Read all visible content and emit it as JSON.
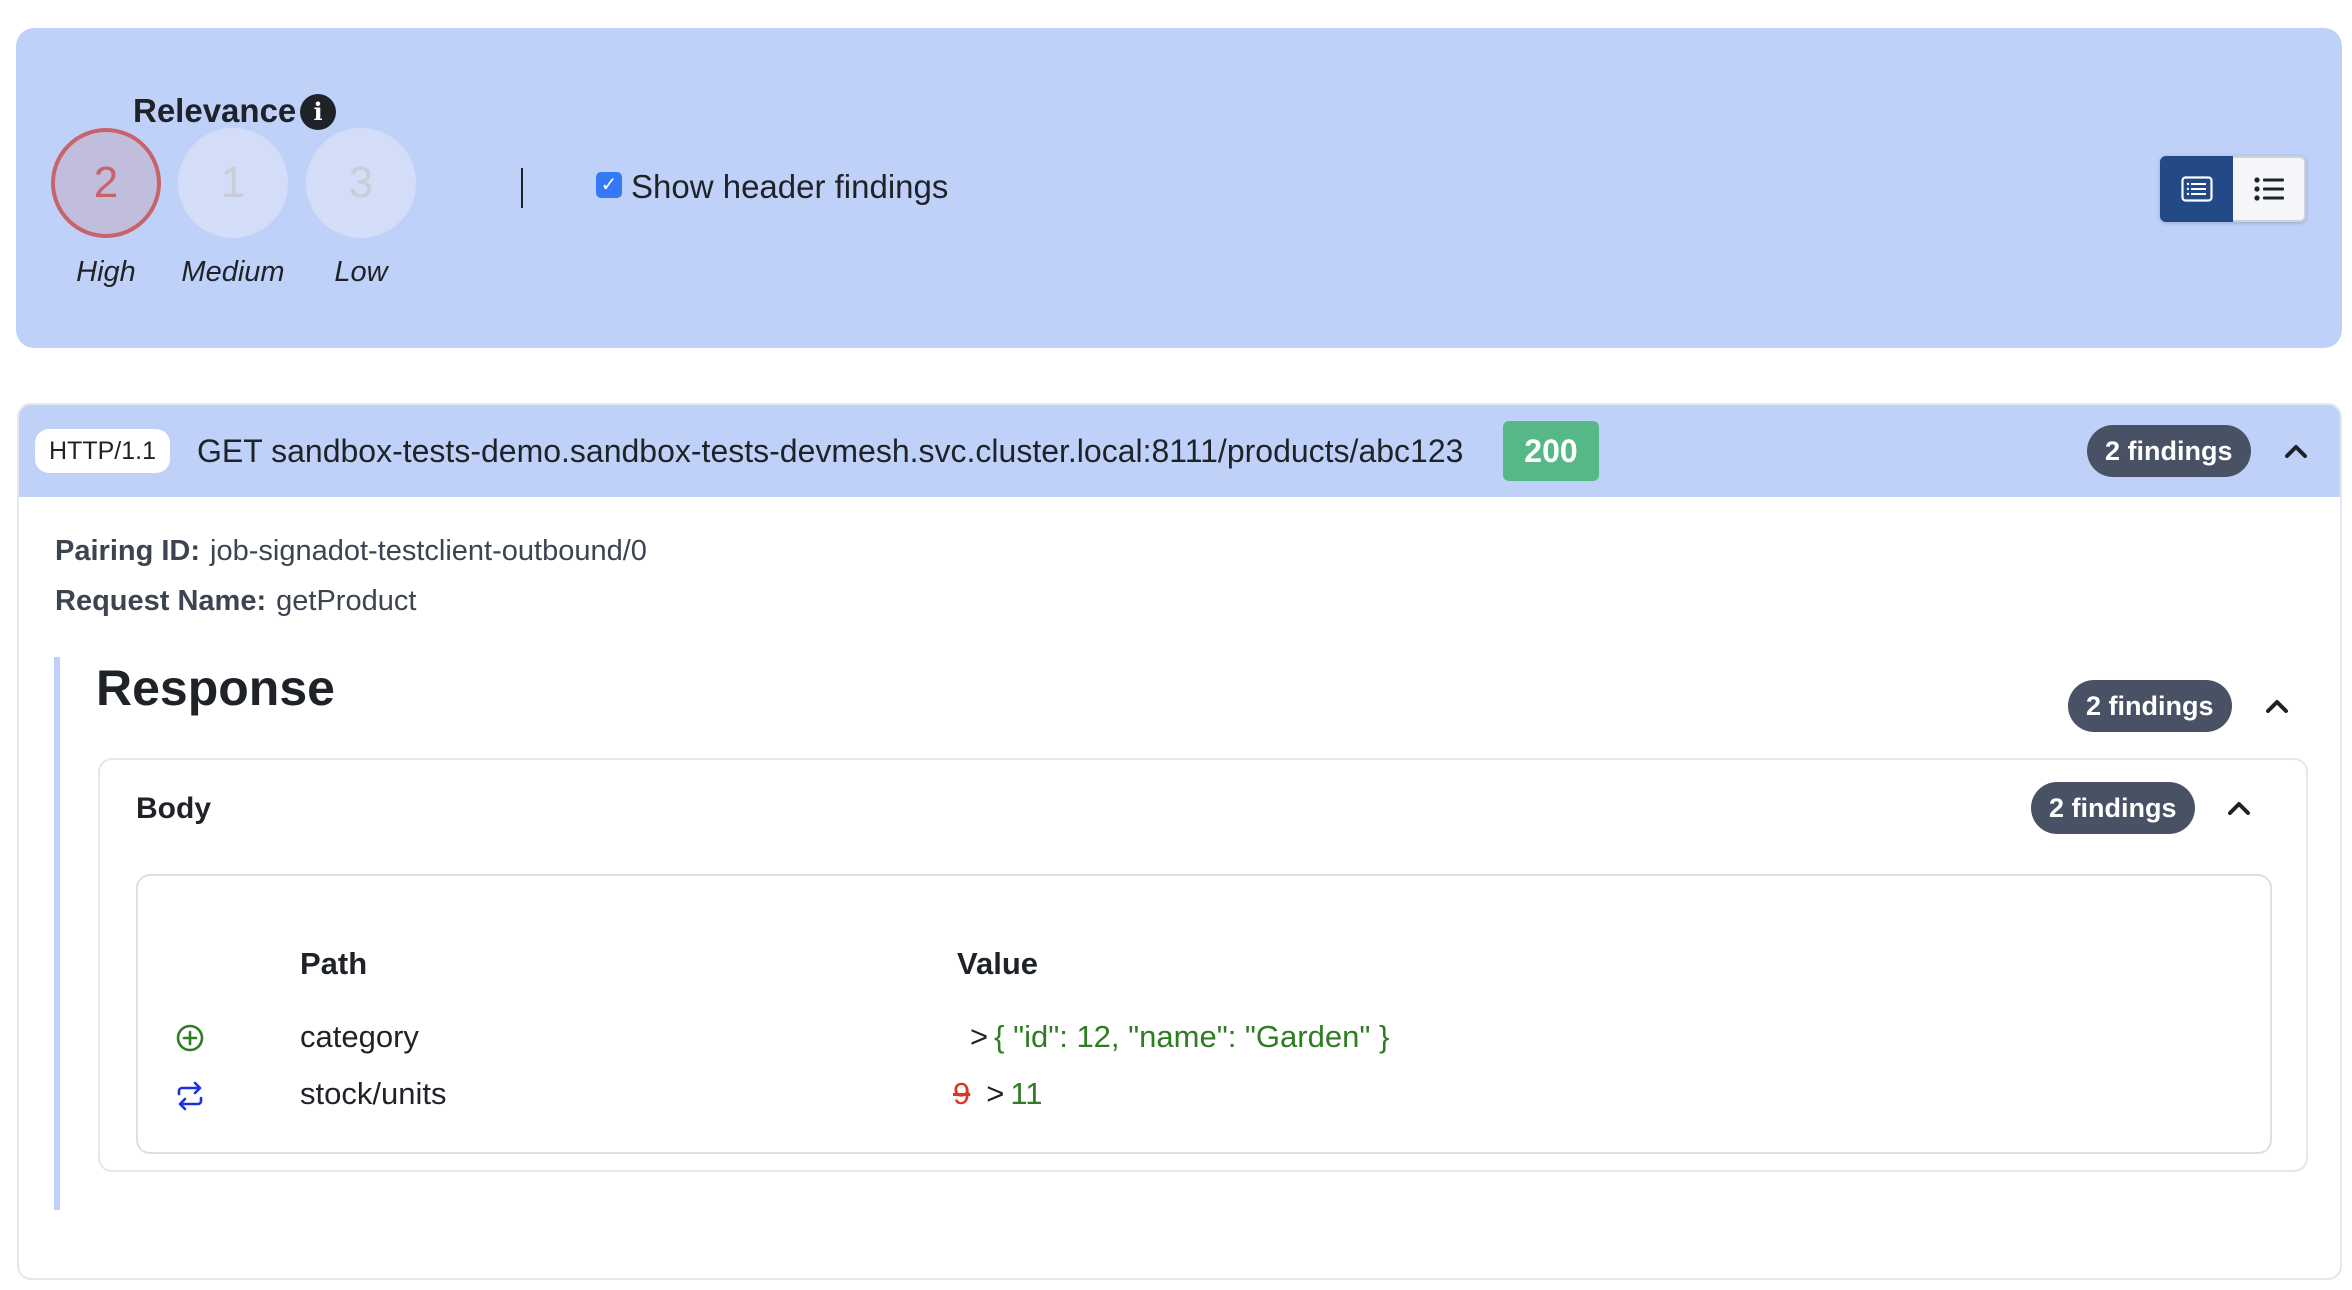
{
  "filters": {
    "relevance_title": "Relevance",
    "info_icon": "info-icon",
    "levels": [
      {
        "label": "High",
        "count": "2",
        "active": true,
        "color": "#c9636b"
      },
      {
        "label": "Medium",
        "count": "1",
        "active": false
      },
      {
        "label": "Low",
        "count": "3",
        "active": false
      }
    ],
    "show_header_findings": {
      "label": "Show header findings",
      "checked": true
    },
    "view_toggle": [
      {
        "name": "detailed-view",
        "icon": "list-card-icon",
        "active": true
      },
      {
        "name": "list-view",
        "icon": "bullet-list-icon",
        "active": false
      }
    ]
  },
  "request": {
    "protocol": "HTTP/1.1",
    "method": "GET",
    "url": "sandbox-tests-demo.sandbox-tests-devmesh.svc.cluster.local:8111/products/abc123",
    "line": "GET sandbox-tests-demo.sandbox-tests-devmesh.svc.cluster.local:8111/products/abc123",
    "status": "200",
    "status_color": "#56b886",
    "findings": "2 findings",
    "pairing_label": "Pairing ID:",
    "pairing_id": "job-signadot-testclient-outbound/0",
    "request_name_label": "Request Name:",
    "request_name": "getProduct"
  },
  "response": {
    "title": "Response",
    "findings": "2 findings",
    "body": {
      "title": "Body",
      "findings": "2 findings",
      "columns": {
        "path": "Path",
        "value": "Value"
      },
      "rows": [
        {
          "type": "added",
          "icon": "plus-circle-icon",
          "path": "category",
          "old": "",
          "arrow": ">",
          "new": "{ \"id\": 12, \"name\": \"Garden\" }"
        },
        {
          "type": "changed",
          "icon": "swap-arrows-icon",
          "path": "stock/units",
          "old": "9",
          "arrow": ">",
          "new": "11"
        }
      ]
    }
  }
}
